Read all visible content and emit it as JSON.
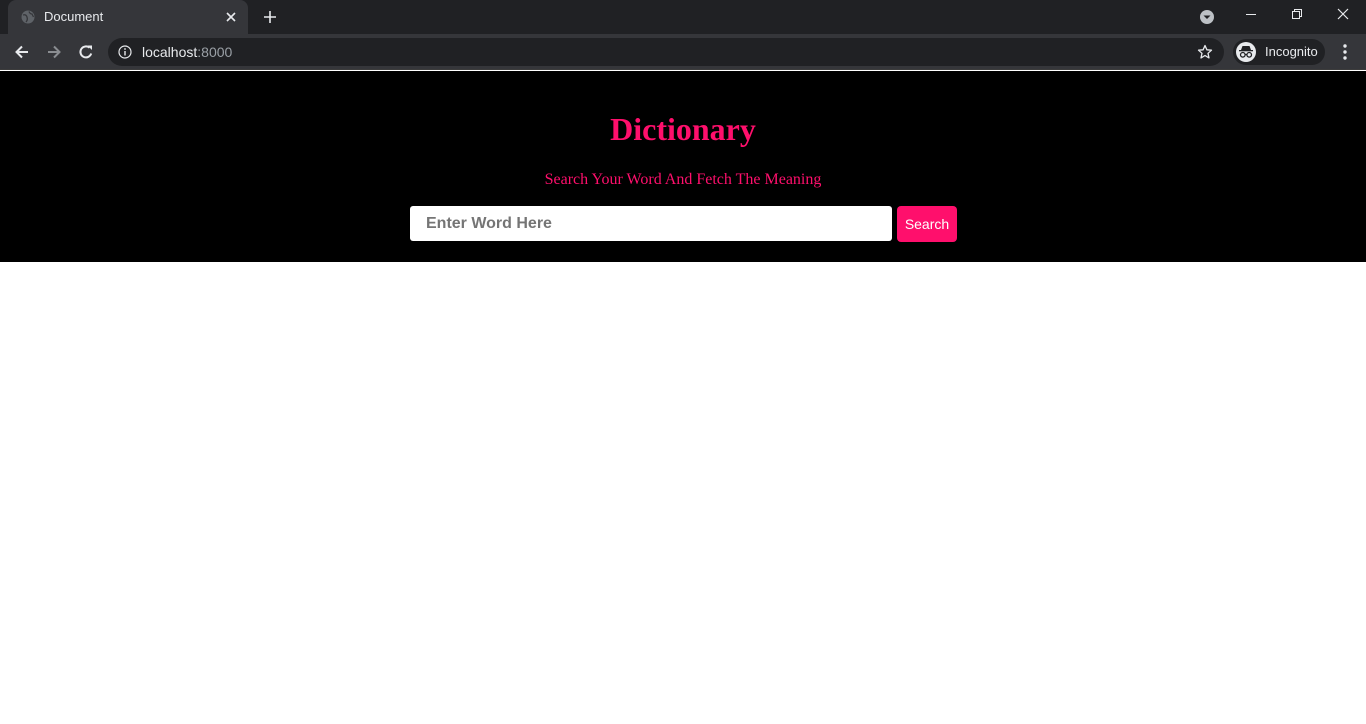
{
  "browser": {
    "tab": {
      "title": "Document"
    },
    "address_bar": {
      "host": "localhost",
      "port": ":8000"
    },
    "profile": {
      "label": "Incognito"
    }
  },
  "page": {
    "title": "Dictionary",
    "subtitle": "Search Your Word And Fetch The Meaning",
    "search": {
      "placeholder": "Enter Word Here",
      "value": "",
      "button_label": "Search"
    }
  },
  "colors": {
    "accent": "#ff0f6c",
    "hero_background": "#000000",
    "chrome_dark": "#202124",
    "chrome_light": "#35363a"
  }
}
